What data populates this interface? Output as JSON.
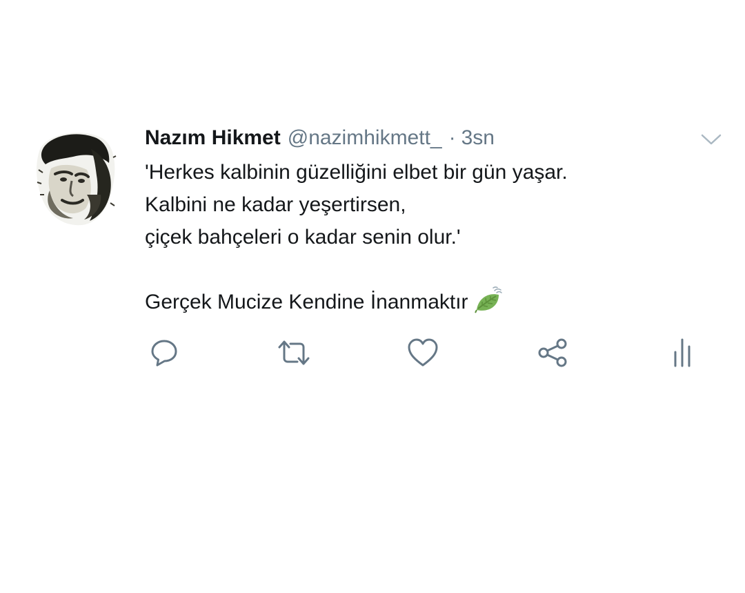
{
  "tweet": {
    "display_name": "Nazım Hikmet",
    "handle": "@nazimhikmett_",
    "separator": "·",
    "time": "3sn",
    "lines": [
      "'Herkes kalbinin güzelliğini elbet bir gün yaşar.",
      "Kalbini ne kadar yeşertirsen,",
      "çiçek bahçeleri o kadar senin olur.'"
    ],
    "closing_line": "Gerçek Mucize Kendine İnanmaktır",
    "emoji": "leaf-fluttering-in-wind-icon"
  },
  "icons": {
    "menu": "chevron-down-icon",
    "reply": "reply-icon",
    "retweet": "retweet-icon",
    "like": "heart-icon",
    "share": "share-icon",
    "analytics": "analytics-icon"
  },
  "colors": {
    "text": "#14171a",
    "secondary": "#657786",
    "icon": "#657786",
    "leaf": "#6ea832"
  }
}
